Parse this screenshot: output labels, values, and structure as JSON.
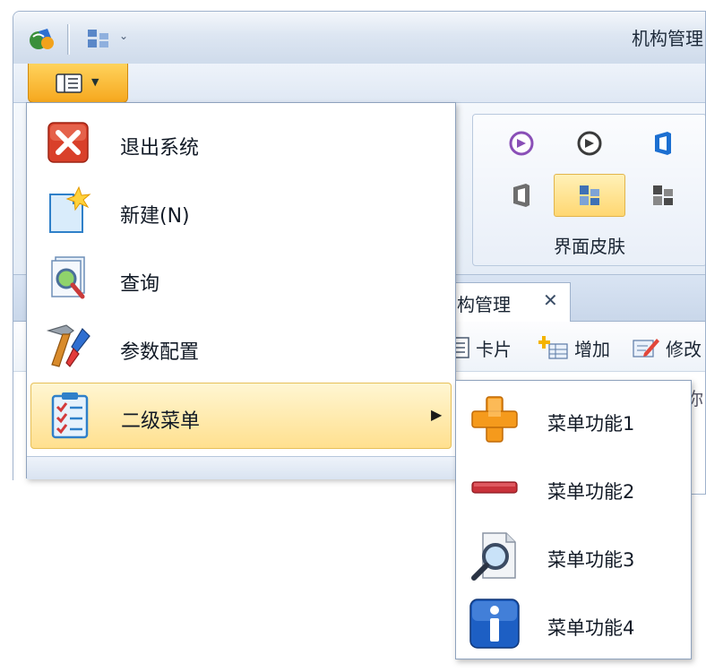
{
  "window": {
    "title": "机构管理"
  },
  "ribbon": {
    "skin_group_label": "界面皮肤"
  },
  "doc_tab": {
    "label": "构管理",
    "close_glyph": "✕"
  },
  "toolbar": {
    "card_label": "卡片",
    "add_label": "增加",
    "edit_label": "修改",
    "partial_text": "你"
  },
  "app_menu": {
    "items": [
      {
        "label": "退出系统",
        "icon": "exit-icon"
      },
      {
        "label": "新建(N)",
        "icon": "new-document-icon"
      },
      {
        "label": "查询",
        "icon": "search-document-icon"
      },
      {
        "label": "参数配置",
        "icon": "tools-icon"
      },
      {
        "label": "二级菜单",
        "icon": "checklist-icon",
        "has_submenu": true
      }
    ],
    "submenu_arrow": "▶"
  },
  "sub_menu": {
    "items": [
      {
        "label": "菜单功能1",
        "icon": "plus-icon"
      },
      {
        "label": "菜单功能2",
        "icon": "minus-icon"
      },
      {
        "label": "菜单功能3",
        "icon": "magnifier-icon"
      },
      {
        "label": "菜单功能4",
        "icon": "info-icon"
      }
    ]
  },
  "colors": {
    "app_button": "#f6a81e",
    "highlight": "#ffe08f",
    "exit_red": "#d9402a",
    "plus_orange": "#f59a1c",
    "minus_red": "#c8323a",
    "info_blue": "#1d5fc4"
  }
}
